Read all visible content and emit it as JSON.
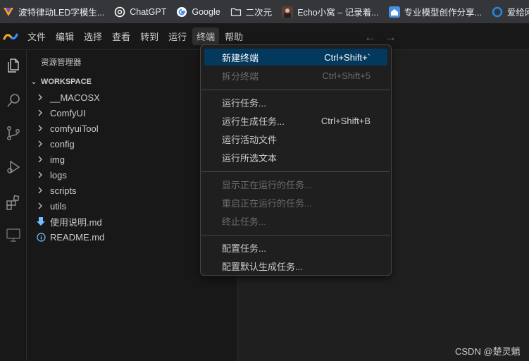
{
  "bookmarks": [
    {
      "label": "波特律动LED字模生...",
      "icon": "v-logo-icon",
      "color": "#f5a623"
    },
    {
      "label": "ChatGPT",
      "icon": "chatgpt-icon",
      "color": "#ffffff"
    },
    {
      "label": "Google",
      "icon": "google-icon",
      "color": "#4285f4"
    },
    {
      "label": "二次元",
      "icon": "folder-icon",
      "color": "#e8eaed"
    },
    {
      "label": "Echo小窝 – 记录着...",
      "icon": "avatar-icon",
      "color": "#8a6a5a"
    },
    {
      "label": "专业模型创作分享...",
      "icon": "home-icon",
      "color": "#4a90e2"
    },
    {
      "label": "爱给网",
      "icon": "c-logo-icon",
      "color": "#1e88e5"
    }
  ],
  "menubar": {
    "items": [
      "文件",
      "编辑",
      "选择",
      "查看",
      "转到",
      "运行",
      "终端",
      "帮助"
    ],
    "active_index": 6
  },
  "sidebar": {
    "title": "资源管理器",
    "workspace": "WORKSPACE",
    "items": [
      {
        "label": "__MACOSX",
        "kind": "folder"
      },
      {
        "label": "ComfyUI",
        "kind": "folder"
      },
      {
        "label": "comfyuiTool",
        "kind": "folder"
      },
      {
        "label": "config",
        "kind": "folder"
      },
      {
        "label": "img",
        "kind": "folder"
      },
      {
        "label": "logs",
        "kind": "folder"
      },
      {
        "label": "scripts",
        "kind": "folder"
      },
      {
        "label": "utils",
        "kind": "folder"
      },
      {
        "label": "使用说明.md",
        "kind": "download-file"
      },
      {
        "label": "README.md",
        "kind": "info-file"
      }
    ]
  },
  "terminal_menu": {
    "groups": [
      [
        {
          "label": "新建终端",
          "shortcut": "Ctrl+Shift+`",
          "state": "highlight"
        },
        {
          "label": "拆分终端",
          "shortcut": "Ctrl+Shift+5",
          "state": "disabled"
        }
      ],
      [
        {
          "label": "运行任务...",
          "shortcut": "",
          "state": "normal"
        },
        {
          "label": "运行生成任务...",
          "shortcut": "Ctrl+Shift+B",
          "state": "normal"
        },
        {
          "label": "运行活动文件",
          "shortcut": "",
          "state": "normal"
        },
        {
          "label": "运行所选文本",
          "shortcut": "",
          "state": "normal"
        }
      ],
      [
        {
          "label": "显示正在运行的任务...",
          "shortcut": "",
          "state": "disabled"
        },
        {
          "label": "重启正在运行的任务...",
          "shortcut": "",
          "state": "disabled"
        },
        {
          "label": "终止任务...",
          "shortcut": "",
          "state": "disabled"
        }
      ],
      [
        {
          "label": "配置任务...",
          "shortcut": "",
          "state": "normal"
        },
        {
          "label": "配置默认生成任务...",
          "shortcut": "",
          "state": "normal"
        }
      ]
    ]
  },
  "watermark": "CSDN @楚灵魈",
  "colors": {
    "accent": "#04395e",
    "background": "#1f1f1f",
    "sidebar": "#181818"
  }
}
